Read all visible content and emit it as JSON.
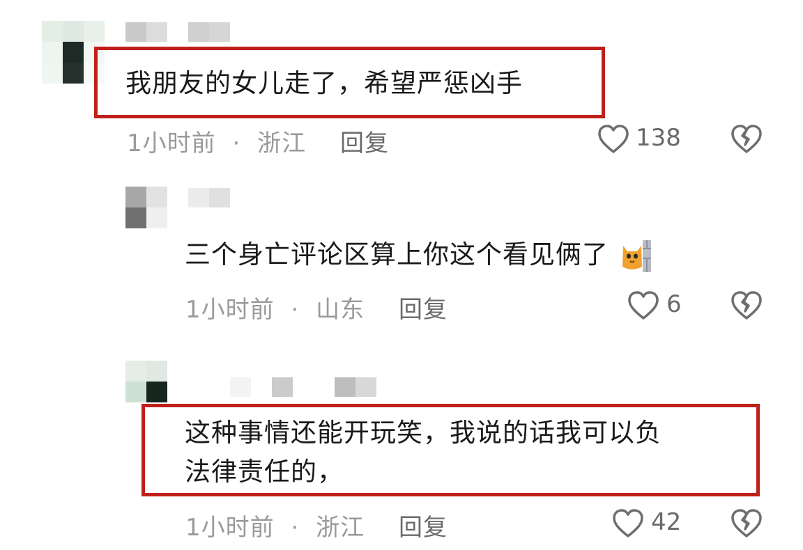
{
  "comments": [
    {
      "text": "我朋友的女儿走了，希望严惩凶手",
      "time": "1小时前",
      "location": "浙江",
      "reply_label": "回复",
      "likes": "138"
    },
    {
      "text": "三个身亡评论区算上你这个看见俩了",
      "time": "1小时前",
      "location": "山东",
      "reply_label": "回复",
      "likes": "6",
      "emoji": "cat-emoji"
    },
    {
      "text_line1": "这种事情还能开玩笑，我说的话我可以负",
      "text_line2": "法律责任的，",
      "time": "1小时前",
      "location": "浙江",
      "reply_label": "回复",
      "likes": "42"
    }
  ],
  "separator": "·",
  "icons": {
    "like": "heart-outline-icon",
    "dislike": "broken-heart-icon"
  },
  "colors": {
    "highlight_border": "#c0201a",
    "meta_text": "#9a9a9a"
  }
}
